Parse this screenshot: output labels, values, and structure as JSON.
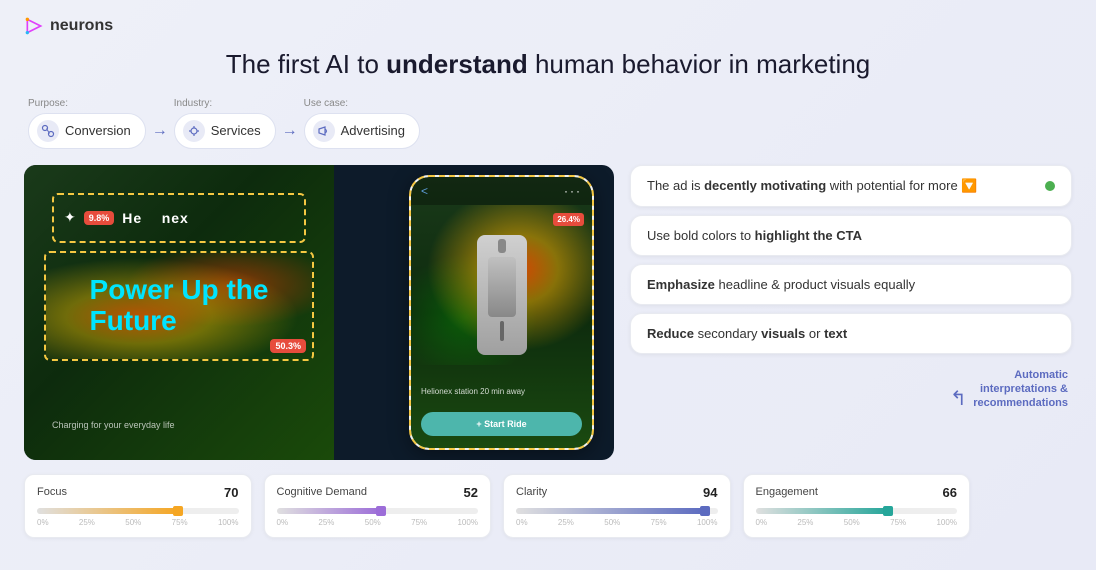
{
  "logo": {
    "name": "neurons",
    "icon": "▶"
  },
  "title": {
    "prefix": "The first AI to ",
    "bold": "understand",
    "suffix": " human behavior in marketing"
  },
  "breadcrumb": {
    "items": [
      {
        "label": "Purpose:",
        "pill": "Conversion",
        "icon": "⟳"
      },
      {
        "label": "Industry:",
        "pill": "Services",
        "icon": "⚙"
      },
      {
        "label": "Use case:",
        "pill": "Advertising",
        "icon": "📣"
      }
    ]
  },
  "ad": {
    "heatmap_badge_1": "9.8%",
    "heatmap_badge_2": "50.3%",
    "heatmap_badge_3": "26.4%",
    "title_text": "Helionex",
    "power_line1": "Power Up the",
    "power_line2": "Future",
    "subtitle": "Charging for your everyday life",
    "phone_station": "Helionex station    20 min away",
    "phone_cta": "+ Start Ride"
  },
  "insights": [
    {
      "id": "main",
      "prefix": "The ad is ",
      "bold": "decently motivating",
      "suffix": " with potential for more 🔽",
      "dot_color": "#4caf50"
    },
    {
      "id": "cta",
      "prefix": "Use bold colors to ",
      "bold": "highlight the CTA",
      "suffix": ""
    },
    {
      "id": "emphasize",
      "prefix": "",
      "bold": "Emphasize",
      "suffix": " headline & product visuals equally"
    },
    {
      "id": "reduce",
      "prefix": "",
      "bold": "Reduce",
      "suffix": " secondary ",
      "bold2": "visuals",
      "suffix2": " or ",
      "bold3": "text"
    }
  ],
  "auto_label": {
    "line1": "Automatic",
    "line2": "interpretations &",
    "line3": "recommendations"
  },
  "metrics": [
    {
      "name": "Focus",
      "value": "70",
      "fill_color": "#f5a623",
      "fill_pct": 70,
      "indicator_color": "#f5a623",
      "ticks": [
        "0%",
        "25%",
        "50%",
        "75%",
        "100%"
      ]
    },
    {
      "name": "Cognitive Demand",
      "value": "52",
      "fill_color": "#9c6dd8",
      "fill_pct": 52,
      "indicator_color": "#9c6dd8",
      "ticks": [
        "0%",
        "25%",
        "50%",
        "75%",
        "100%"
      ]
    },
    {
      "name": "Clarity",
      "value": "94",
      "fill_color": "#5c6bc0",
      "fill_pct": 94,
      "indicator_color": "#5c6bc0",
      "ticks": [
        "0%",
        "25%",
        "50%",
        "75%",
        "100%"
      ]
    },
    {
      "name": "Engagement",
      "value": "66",
      "fill_color": "#26a69a",
      "fill_pct": 66,
      "indicator_color": "#26a69a",
      "ticks": [
        "0%",
        "25%",
        "50%",
        "75%",
        "100%"
      ]
    }
  ]
}
